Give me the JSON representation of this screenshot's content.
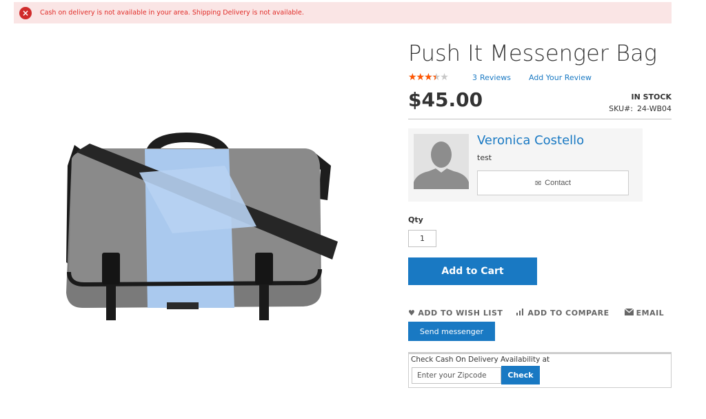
{
  "alert": {
    "icon": "error-x-icon",
    "message": "Cash on delivery is not available in your area. Shipping Delivery is not available."
  },
  "product": {
    "title": "Push It Messenger Bag",
    "rating_fraction": 0.6,
    "reviews_count": "3",
    "reviews_label": "Reviews",
    "add_review_label": "Add Your Review",
    "price": "$45.00",
    "stock": "IN STOCK",
    "sku_label": "SKU#:",
    "sku_value": "24-WB04",
    "image_icon": "messenger-bag-image"
  },
  "seller": {
    "name": "Veronica Costello",
    "subtitle": "test",
    "contact_label": "Contact",
    "avatar_icon": "person-silhouette-icon"
  },
  "form": {
    "qty_label": "Qty",
    "qty_value": "1",
    "add_to_cart_label": "Add to Cart"
  },
  "actions": {
    "wishlist_label": "ADD TO WISH LIST",
    "compare_label": "ADD TO COMPARE",
    "email_label": "EMAIL",
    "messenger_label": "Send messenger"
  },
  "cod": {
    "label": "Check Cash On Delivery Availability at",
    "zip_placeholder": "Enter your Zipcode",
    "check_label": "Check"
  },
  "colors": {
    "accent": "#1979c3",
    "error_bg": "#fae5e5",
    "error_text": "#e02b27",
    "star": "#ff5501"
  }
}
